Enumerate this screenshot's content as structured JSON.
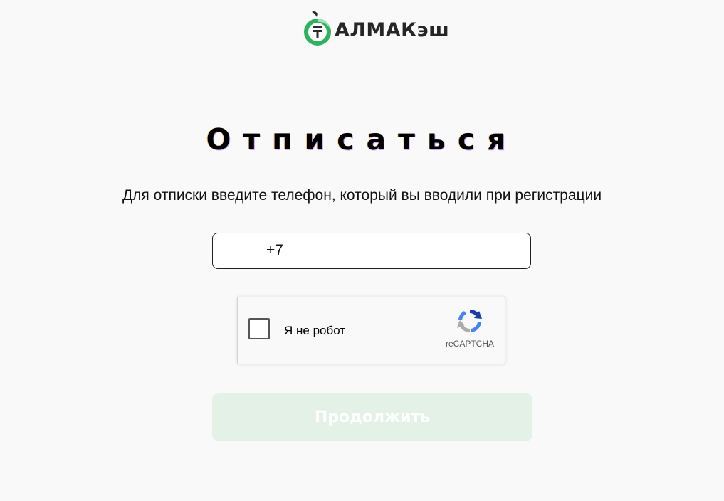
{
  "brand": {
    "name": "АЛМАКэш",
    "logo_icon": "tenge-apple-logo-icon",
    "accent_color": "#2db25e"
  },
  "page": {
    "title": "Отписаться",
    "subtitle": "Для отписки введите телефон, который вы вводили при регистрации"
  },
  "phone": {
    "value": "+7",
    "placeholder": ""
  },
  "captcha": {
    "label": "Я не робот",
    "brand": "reCAPTCHA",
    "checked": false
  },
  "continue_button": {
    "label": "Продолжить",
    "enabled": false,
    "background": "#e3f1e6"
  }
}
